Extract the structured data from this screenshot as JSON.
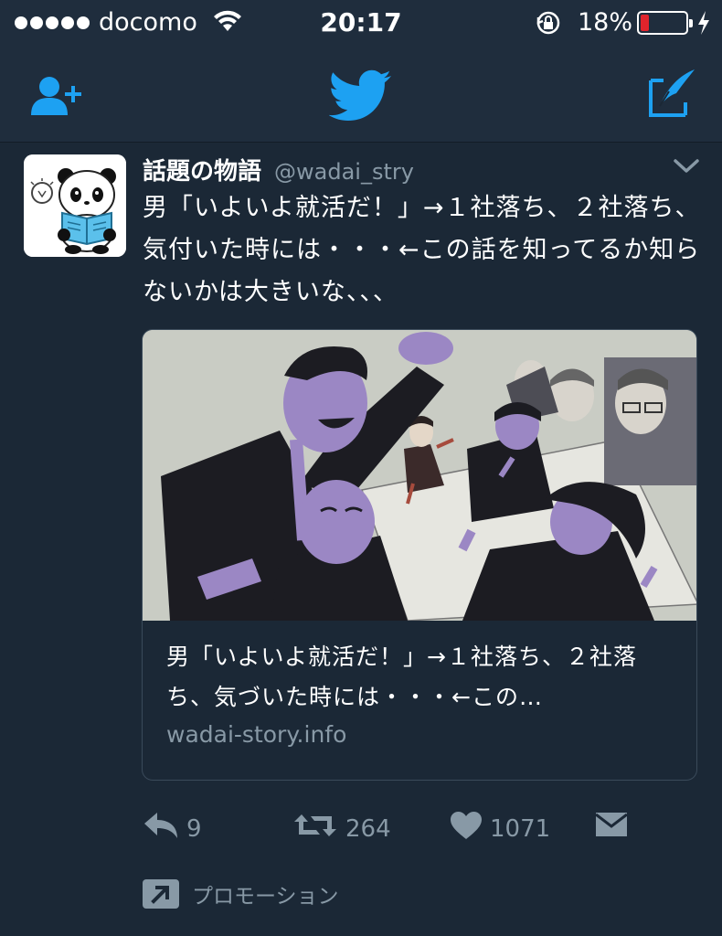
{
  "status_bar": {
    "carrier": "docomo",
    "time": "20:17",
    "battery_percent": "18%",
    "battery_level": 0.18,
    "signal_dots": 5,
    "icons": [
      "signal-dots-icon",
      "wifi-icon",
      "rotation-lock-icon",
      "battery-icon",
      "charging-bolt-icon"
    ]
  },
  "nav_bar": {
    "left_icon": "add-user-icon",
    "center_icon": "twitter-bird-icon",
    "right_icon": "compose-tweet-icon"
  },
  "tweet": {
    "display_name": "話題の物語",
    "handle": "@wadai_stry",
    "text": "男「いよいよ就活だ！」→１社落ち、２社落ち、気付いた時には・・・←この話を知ってるか知らないかは大きいな、、、",
    "card": {
      "title": "男「いよいよ就活だ！」→１社落ち、２社落ち、気づいた時には・・・←この…",
      "domain": "wadai-story.info"
    },
    "actions": {
      "reply_count": "9",
      "retweet_count": "264",
      "like_count": "1071"
    },
    "promoted_label": "プロモーション"
  },
  "colors": {
    "background": "#1b2836",
    "bar_background": "#1f2d3d",
    "accent": "#1da1f2",
    "muted": "#8899a6",
    "battery_low": "#e0242c",
    "illustration_bg": "#c9ccc4",
    "illustration_face": "#9b87c4"
  }
}
